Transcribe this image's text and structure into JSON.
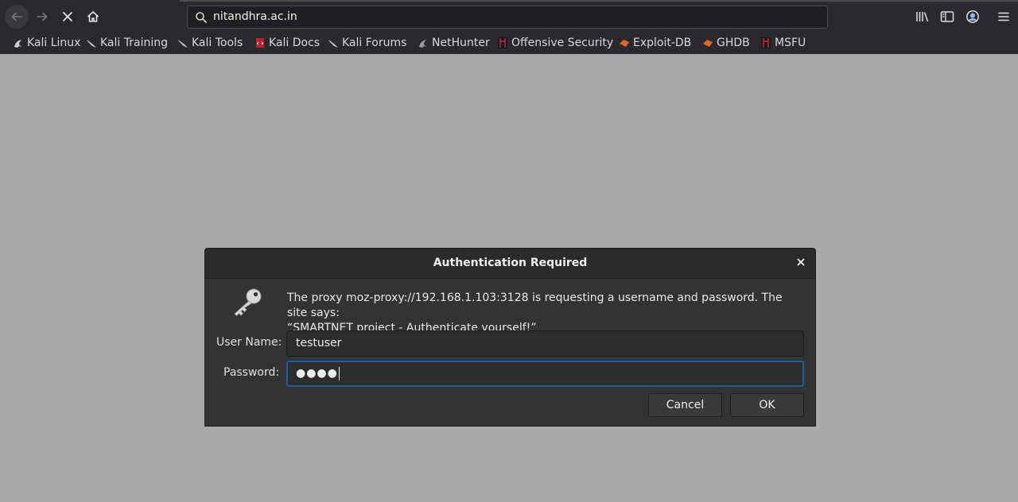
{
  "browser": {
    "url": "nitandhra.ac.in",
    "icons": {
      "back": "back-arrow-icon",
      "forward": "forward-arrow-icon",
      "stop": "stop-loading-icon",
      "home": "home-icon",
      "search": "search-icon",
      "library": "library-icon",
      "sidebar": "sidebar-icon",
      "account": "account-icon",
      "menu": "hamburger-menu-icon"
    }
  },
  "bookmarks": [
    {
      "label": "Kali Linux",
      "icon": "kali-dragon-icon"
    },
    {
      "label": "Kali Training",
      "icon": "kali-dragon-icon"
    },
    {
      "label": "Kali Tools",
      "icon": "kali-dragon-icon"
    },
    {
      "label": "Kali Docs",
      "icon": "kali-docs-icon"
    },
    {
      "label": "Kali Forums",
      "icon": "kali-dragon-icon"
    },
    {
      "label": "NetHunter",
      "icon": "nethunter-icon"
    },
    {
      "label": "Offensive Security",
      "icon": "offsec-icon"
    },
    {
      "label": "Exploit-DB",
      "icon": "exploit-db-icon"
    },
    {
      "label": "GHDB",
      "icon": "ghdb-icon"
    },
    {
      "label": "MSFU",
      "icon": "msfu-icon"
    }
  ],
  "dialog": {
    "title": "Authentication Required",
    "message_line1": "The proxy moz-proxy://192.168.1.103:3128 is requesting a username and password. The site says:",
    "message_line2": "“SMARTNET project - Authenticate yourself!”",
    "username_label": "User Name:",
    "username_value": "testuser",
    "password_label": "Password:",
    "password_masked": "●●●●",
    "cancel_label": "Cancel",
    "ok_label": "OK"
  },
  "colors": {
    "chrome_bg": "#2a2a2e",
    "page_bg": "#a9a9a9",
    "dialog_bg": "#333333",
    "focus_accent": "#215d9c"
  }
}
